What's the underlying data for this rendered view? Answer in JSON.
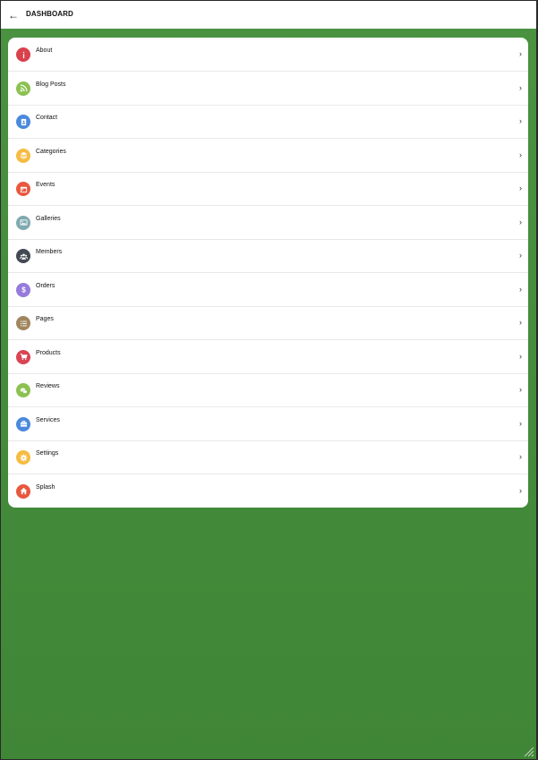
{
  "header": {
    "title": "DASHBOARD",
    "back_icon": "arrow-left-icon"
  },
  "menu": [
    {
      "label": "About",
      "icon": "info-icon",
      "color": "#d9414d"
    },
    {
      "label": "Blog Posts",
      "icon": "feed-icon",
      "color": "#8cc152"
    },
    {
      "label": "Contact",
      "icon": "contact-card-icon",
      "color": "#4a89dc"
    },
    {
      "label": "Categories",
      "icon": "layers-icon",
      "color": "#f6bb42"
    },
    {
      "label": "Events",
      "icon": "calendar-icon",
      "color": "#e9573f"
    },
    {
      "label": "Galleries",
      "icon": "image-icon",
      "color": "#7fa9b0"
    },
    {
      "label": "Members",
      "icon": "users-icon",
      "color": "#434a54"
    },
    {
      "label": "Orders",
      "icon": "dollar-icon",
      "color": "#967adc"
    },
    {
      "label": "Pages",
      "icon": "list-icon",
      "color": "#a0865e"
    },
    {
      "label": "Products",
      "icon": "cart-icon",
      "color": "#da4453"
    },
    {
      "label": "Reviews",
      "icon": "chat-icon",
      "color": "#8cc152"
    },
    {
      "label": "Services",
      "icon": "briefcase-icon",
      "color": "#4a89dc"
    },
    {
      "label": "Settings",
      "icon": "gear-icon",
      "color": "#f6bb42"
    },
    {
      "label": "Splash",
      "icon": "home-icon",
      "color": "#e9573f"
    }
  ],
  "background_color": "#438b3a"
}
